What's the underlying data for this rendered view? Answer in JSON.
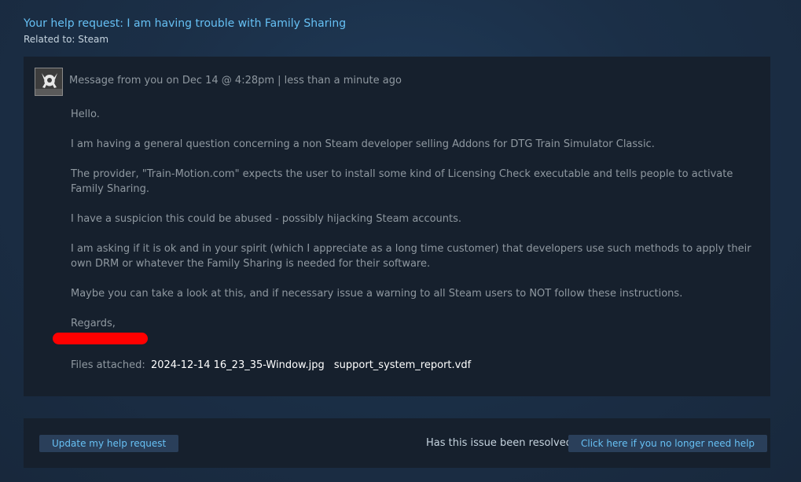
{
  "header": {
    "title": "Your help request: I am having trouble with Family Sharing",
    "related": "Related to: Steam"
  },
  "message": {
    "meta": "Message from you on Dec 14 @ 4:28pm | less than a minute ago",
    "paragraphs": [
      "Hello.",
      "I am having a general question concerning a non Steam developer selling Addons for DTG Train Simulator Classic.",
      "The provider, \"Train-Motion.com\" expects the user to install some kind of Licensing Check executable and tells people to activate Family Sharing.",
      "I have a suspicion this could be abused - possibly hijacking Steam accounts.",
      "I am asking if it is ok and in your spirit (which I appreciate as a long time customer) that developers use such methods to apply their own DRM or whatever the Family Sharing is needed for their software.",
      "Maybe you can take a look at this, and if necessary issue a warning to all Steam users to NOT follow these instructions.",
      "Regards,"
    ],
    "files_label": "Files attached:",
    "files": [
      "2024-12-14 16_23_35-Window.jpg",
      "support_system_report.vdf"
    ]
  },
  "footer": {
    "update_button": "Update my help request",
    "resolved_question": "Has this issue been resolved?",
    "no_help_button": "Click here if you no longer need help"
  },
  "colors": {
    "accent": "#66c0f4",
    "panel": "#16202d",
    "button_bg": "#2a3f5a",
    "redaction": "#ff0000"
  }
}
